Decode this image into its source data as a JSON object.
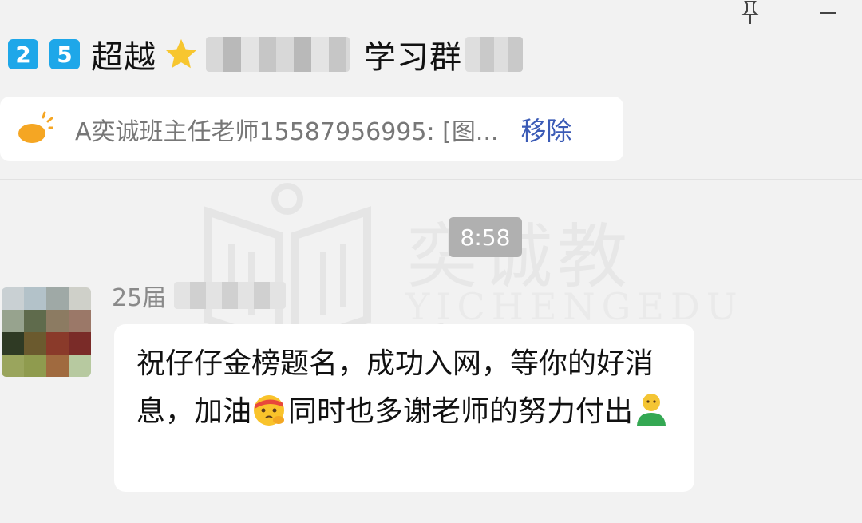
{
  "window": {
    "pin_icon": "pin-icon",
    "minimize_icon": "minimize-icon"
  },
  "header": {
    "badges": [
      "2",
      "5"
    ],
    "title_start": "超越",
    "title_star_icon": "star-icon",
    "title_end": "学习群"
  },
  "announcement": {
    "icon": "sun-icon",
    "text": "A奕诚班主任老师15587956995: [图...",
    "remove_label": "移除"
  },
  "watermark": {
    "cn": "奕诚教育",
    "en": "YICHENGEDU"
  },
  "chat": {
    "time": "8:58",
    "sender_prefix": "25届",
    "message_part1": "祝仔仔金榜题名，成功入网，等你的好消息，加油",
    "emoji1": "salute-face-emoji",
    "message_part2": "同时也多谢老师的努力付出",
    "emoji2": "person-emoji"
  },
  "colors": {
    "badge": "#1ea7e9",
    "remove_link": "#3b5bb6",
    "background": "#f2f2f2"
  }
}
